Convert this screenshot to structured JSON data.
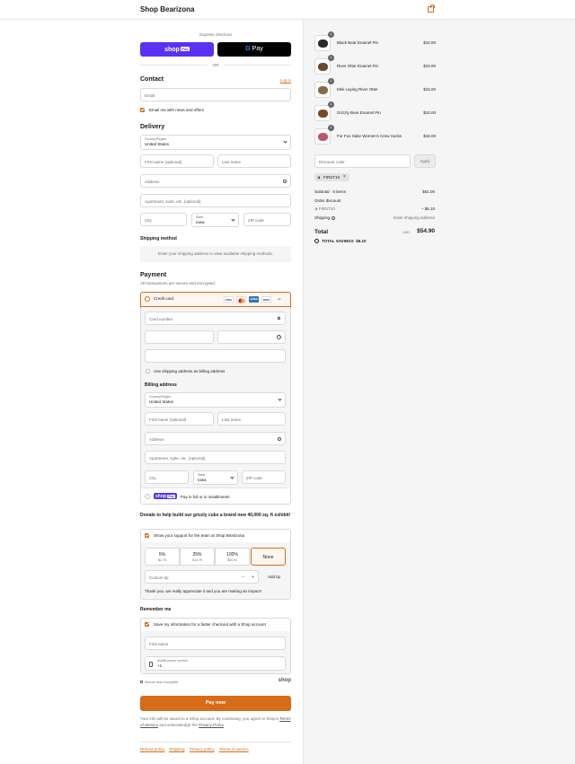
{
  "header": {
    "brand": "Shop Bearizona",
    "bag_icon": "shopping-bag-icon"
  },
  "express": {
    "title": "Express checkout",
    "shop_pay_label": "shop",
    "shop_pay_badge": "Pay",
    "gpay_label": "Pay",
    "gpay_g": "G",
    "or": "OR"
  },
  "contact": {
    "heading": "Contact",
    "login": "Log in",
    "email_placeholder": "Email",
    "news_label": "Email me with news and offers",
    "news_checked": true
  },
  "delivery": {
    "heading": "Delivery",
    "country_label": "Country/Region",
    "country_value": "United States",
    "first_name": "First name (optional)",
    "last_name": "Last name",
    "address": "Address",
    "apartment": "Apartment, suite, etc. (optional)",
    "city": "City",
    "state_label": "State",
    "state_value": "Iowa",
    "zip": "ZIP code"
  },
  "shipping": {
    "heading": "Shipping method",
    "message": "Enter your shipping address to view available shipping methods."
  },
  "payment": {
    "heading": "Payment",
    "subtitle": "All transactions are secure and encrypted.",
    "credit_card_label": "Credit card",
    "card_logos": [
      "VISA",
      "MC",
      "AMEX",
      "DISC",
      "+4"
    ],
    "card_number": "Card number",
    "expiration": "",
    "security": "",
    "name_on_card": "",
    "billing_same_label": "Use shipping address as billing address",
    "billing_heading": "Billing address",
    "billing_country_label": "Country/Region",
    "billing_country_value": "United States",
    "billing_first_name": "First name (optional)",
    "billing_last_name": "Last name",
    "billing_address": "Address",
    "billing_apartment": "Apartment, suite, etc. (optional)",
    "billing_city": "City",
    "billing_state_label": "State",
    "billing_state_value": "Iowa",
    "billing_zip": "ZIP code",
    "shoppay_logo": "shop",
    "shoppay_badge": "Pay",
    "shoppay_text": "Pay in full or in installments"
  },
  "donate": {
    "heading": "Donate to help build our grizzly cubs a brand new 40,000 sq. ft exhibit!",
    "support_label": "Show your support for the team at Shop Bearizona",
    "options": [
      {
        "pct": "5%",
        "amt": "$2.75"
      },
      {
        "pct": "25%",
        "amt": "$13.75"
      },
      {
        "pct": "100%",
        "amt": "$54.90"
      },
      {
        "pct": "None",
        "amt": ""
      }
    ],
    "selected": "None",
    "custom_placeholder": "Custom tip",
    "minus": "−",
    "plus": "+",
    "add_tip": "Add tip",
    "thanks": "Thank you, we really appreciate it and you are making an impact!"
  },
  "remember": {
    "heading": "Remember me",
    "save_label": "Save my information for a faster checkout with a Shop account",
    "first_name": "First name",
    "phone_label": "Mobile phone number",
    "phone_value": "+1",
    "secure": "Secure and encrypted",
    "shop_logo": "shop"
  },
  "paynow": "Pay now",
  "legal": {
    "line1": "Your info will be saved to a Shop account. By continuing, you agree to Shop's",
    "terms": "Terms of Service",
    "and_ack": "and acknowledge the",
    "privacy": "Privacy Policy",
    "period": "."
  },
  "footer_links": [
    "Refund policy",
    "Shipping",
    "Privacy policy",
    "Terms of service"
  ],
  "order": {
    "items": [
      {
        "name": "Black Bear Enamel Pin",
        "price": "$10.00",
        "qty": "1",
        "color": "#2b2b2b"
      },
      {
        "name": "River Otter Enamel Pin",
        "price": "$10.00",
        "qty": "1",
        "color": "#6b4a2b"
      },
      {
        "name": "Mini Laying River Otter",
        "price": "$15.00",
        "qty": "1",
        "color": "#8a6a45"
      },
      {
        "name": "Grizzly Bear Enamel Pin",
        "price": "$10.00",
        "qty": "1",
        "color": "#7a4a24"
      },
      {
        "name": "For Fox Sake Women's Crew Socks",
        "price": "$16.00",
        "qty": "1",
        "color": "#c0566b"
      }
    ],
    "discount_placeholder": "Discount code",
    "apply": "Apply",
    "applied_code": "FIRST10",
    "subtotal_label": "Subtotal · 5 items",
    "subtotal_value": "$61.00",
    "order_discount_label": "Order discount",
    "discount_code": "FIRST10",
    "discount_value": "− $6.10",
    "shipping_label": "Shipping",
    "shipping_value": "Enter shipping address",
    "total_label": "Total",
    "currency": "USD",
    "total_value": "$54.90",
    "savings_label": "TOTAL SAVINGS",
    "savings_value": "$6.10"
  },
  "colors": {
    "accent": "#d66c17",
    "shop_pay": "#5a31f4"
  }
}
